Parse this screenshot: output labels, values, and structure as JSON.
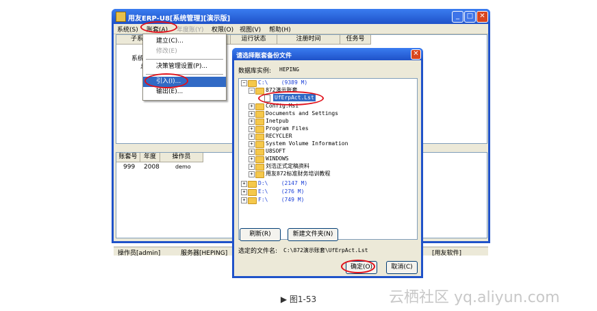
{
  "main_window": {
    "title": "用友ERP-U8[系统管理][演示版]",
    "menu": [
      "系统(S)",
      "账套(A)",
      "年度账(Y)",
      "权限(O)",
      "视图(V)",
      "帮助(H)"
    ],
    "grid_top": {
      "columns": [
        "子系",
        "运行状态",
        "注册时间",
        "任务号"
      ],
      "rows": [
        "系统",
        "总"
      ]
    },
    "grid_bottom": {
      "columns": [
        "账套号",
        "年度",
        "操作员"
      ],
      "row": [
        "999",
        "2008",
        "demo"
      ]
    },
    "status": {
      "operator": "操作员[admin]",
      "server": "服务器[HEPING]",
      "vendor": "[用友软件]"
    }
  },
  "dropdown": {
    "items": [
      "建立(C)...",
      "修改(E)",
      "决策管理设置(P)...",
      "引入(I)...",
      "输出(E)..."
    ]
  },
  "dialog": {
    "title": "请选择账套备份文件",
    "db_label": "数据库实例:",
    "db_value": "HEPING",
    "tree": {
      "c_drive": "C:\\",
      "c_size": "(9389 M)",
      "folder_open": "872演示账套",
      "selected_file": "UfErpAct.Lst",
      "folders": [
        "Config.Msi",
        "Documents and Settings",
        "Inetpub",
        "Program Files",
        "RECYCLER",
        "System Volume Information",
        "U8SOFT",
        "WINDOWS",
        "刘浩正式定稿资料",
        "用友872标准财务培训教程"
      ],
      "d_drive": "D:\\",
      "d_size": "(2147 M)",
      "e_drive": "E:\\",
      "e_size": "(276 M)",
      "f_drive": "F:\\",
      "f_size": "(749 M)"
    },
    "refresh_button": "刷新(R)",
    "new_folder_button": "新建文件夹(N)",
    "selected_label": "选定的文件名:",
    "selected_path": "C:\\872演示账套\\UfErpAct.Lst",
    "ok_button": "确定(O)",
    "cancel_button": "取消(C)"
  },
  "caption": "▶ 图1-53",
  "watermark": "云栖社区 yq.aliyun.com",
  "colors": {
    "titlebar": "#1f52c9",
    "highlight": "#e0101a",
    "selection": "#316ac5"
  }
}
